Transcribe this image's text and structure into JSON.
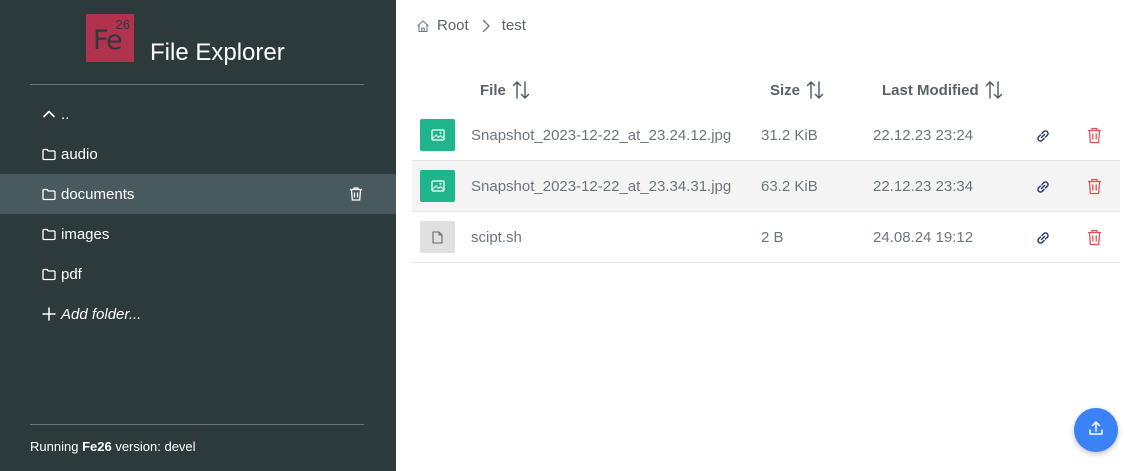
{
  "brand": {
    "logo_symbol": "Fe",
    "logo_number": "26",
    "title": "File Explorer",
    "logo_color": "#b0324f"
  },
  "sidebar": {
    "items": [
      {
        "label": "..",
        "icon": "chevron-up-icon"
      },
      {
        "label": "audio",
        "icon": "folder-icon"
      },
      {
        "label": "documents",
        "icon": "folder-icon",
        "active": true,
        "action_icon": "trash-icon"
      },
      {
        "label": "images",
        "icon": "folder-icon"
      },
      {
        "label": "pdf",
        "icon": "folder-icon"
      },
      {
        "label": "Add folder...",
        "icon": "plus-icon"
      }
    ],
    "background": "#2d3a3c",
    "active_background": "#485a5d"
  },
  "footer": {
    "prefix": "Running",
    "app": "Fe26",
    "suffix": "version: devel"
  },
  "breadcrumb": {
    "items": [
      "Root",
      "test"
    ]
  },
  "table": {
    "columns": [
      "File",
      "Size",
      "Last Modified"
    ],
    "rows": [
      {
        "type": "image",
        "name": "Snapshot_2023-12-22_at_23.24.12.jpg",
        "size": "31.2 KiB",
        "modified": "22.12.23 23:24"
      },
      {
        "type": "image",
        "name": "Snapshot_2023-12-22_at_23.34.31.jpg",
        "size": "63.2 KiB",
        "modified": "22.12.23 23:34"
      },
      {
        "type": "file",
        "name": "scipt.sh",
        "size": "2 B",
        "modified": "24.08.24 19:12"
      }
    ]
  },
  "colors": {
    "image_thumb": "#1fb58b",
    "delete": "#e05252",
    "link": "#2d3a6c",
    "upload_button": "#3b82f6"
  }
}
